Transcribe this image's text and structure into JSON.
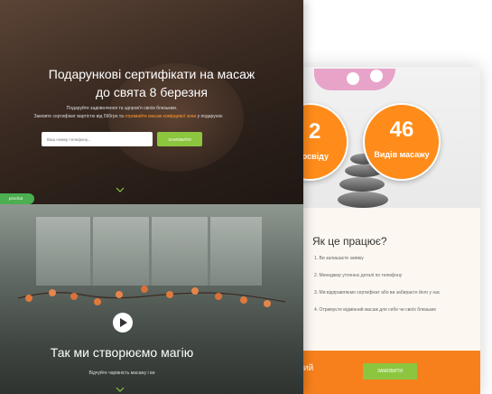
{
  "back_page": {
    "stat1": {
      "number": "2",
      "label": "досвіду"
    },
    "stat2": {
      "number": "46",
      "label": "Видів масажу"
    },
    "how_title": "Як це працює?",
    "steps": [
      "1. Ви залишаєте заявку",
      "2. Менеджер уточнює деталі по телефону",
      "3. Ми відправляємо сертифікат або ви забираєте його у нас",
      "4. Отримуєте відмінний масаж для себе чи своїх близьких"
    ],
    "footer_text": "ий",
    "footer_button": "ЗАМОВИТИ"
  },
  "hero": {
    "title_line1": "Подарункові сертифікати на масаж",
    "title_line2": "до свята 8 березня",
    "subtitle_line1": "Подаруйте задоволення та здоров'я своїм близьким.",
    "subtitle_line2_before": "Замовте сертифікат вартістю від 590грн та ",
    "subtitle_line2_highlight": "отримайте масаж комірцевої зони",
    "subtitle_line2_after": " у подарунок",
    "phone_placeholder": "Ваш номер телефону...",
    "order_button": "ЗАМОВИТИ",
    "badge": "prochat"
  },
  "video": {
    "title": "Так ми створюємо магію",
    "subtitle": "Відчуйте чарівність масажу і ви"
  },
  "colors": {
    "accent_orange": "#ff8c1a",
    "accent_green": "#8cc63f",
    "badge_green": "#4caf50"
  }
}
